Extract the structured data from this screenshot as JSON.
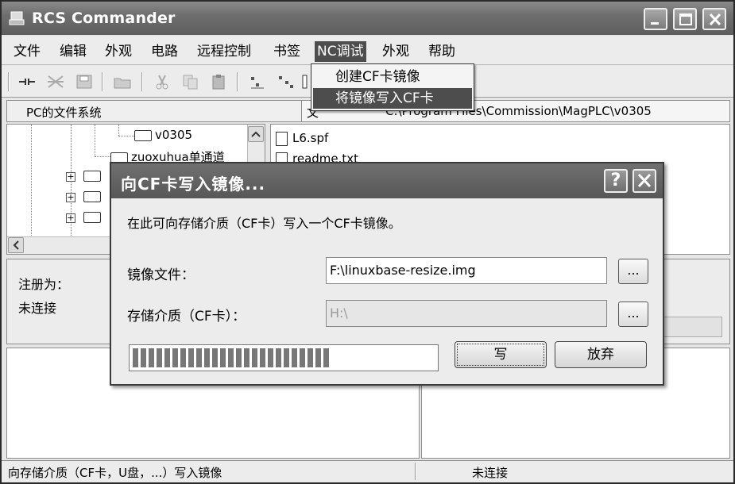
{
  "app": {
    "title": "RCS Commander"
  },
  "menu": {
    "items": [
      "文件",
      "编辑",
      "外观",
      "电路",
      "远程控制",
      "书签",
      "NC调试",
      "外观",
      "帮助"
    ],
    "dropdown": [
      "创建CF卡镜像",
      "将镜像写入CF卡"
    ]
  },
  "pathbar": {
    "pc_fs_label": "PC的文件系统",
    "path_label": "文",
    "path_value": "C:\\Program Files\\Commission\\MagPLC\\v0305"
  },
  "tree": {
    "items": [
      "v0305",
      "zuoxuhua单通道"
    ]
  },
  "files": {
    "items": [
      "L6.spf",
      "readme.txt"
    ]
  },
  "info": {
    "registered_label": "注册为：",
    "connection_status": "未连接"
  },
  "dialog": {
    "title": "向CF卡写入镜像...",
    "description": "在此可向存储介质（CF卡）写入一个CF卡镜像。",
    "image_label": "镜像文件：",
    "image_value": "F:\\linuxbase-resize.img",
    "media_label": "存储介质（CF卡）：",
    "media_value": "H:\\",
    "browse_label": "...",
    "help_label": "?",
    "write_label": "写",
    "cancel_label": "放弃",
    "progress_fraction": 0.66
  },
  "statusbar": {
    "left": "向存储介质（CF卡，U盘，...）写入镜像",
    "right": "未连接"
  }
}
